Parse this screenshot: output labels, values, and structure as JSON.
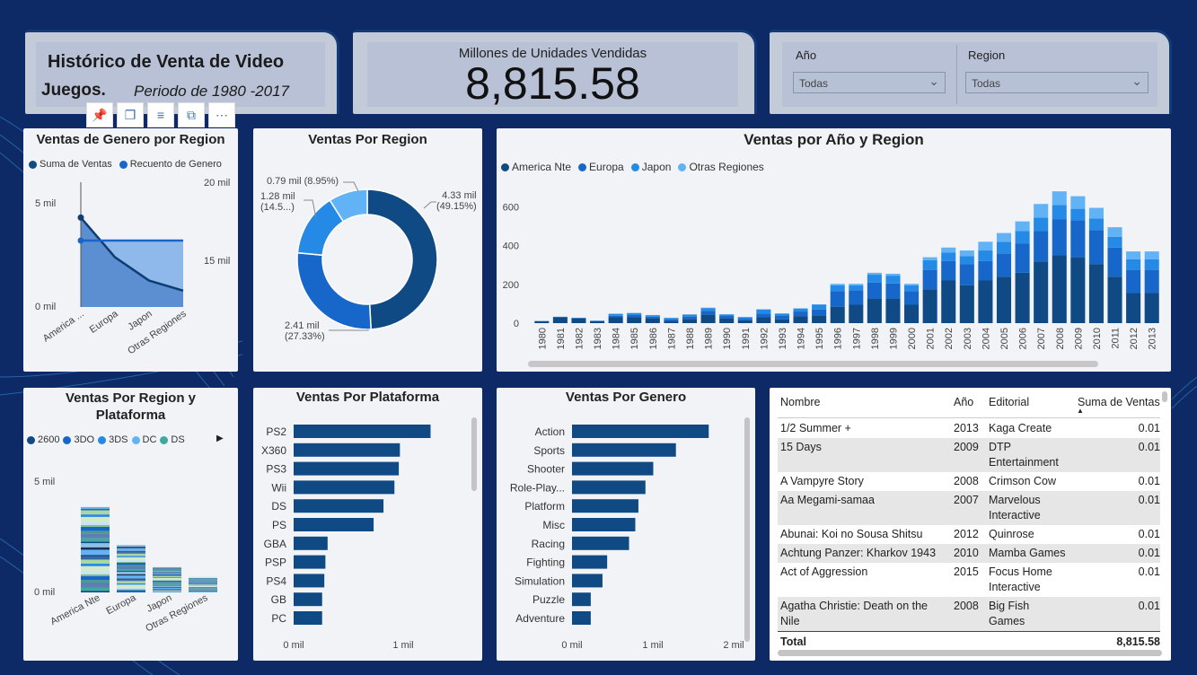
{
  "header": {
    "title_line1": "Histórico de Venta de Video",
    "title_line2": "Juegos.",
    "period": "Periodo de  1980 -2017",
    "kpi_label": "Millones de Unidades Vendidas",
    "kpi_value": "8,815.58"
  },
  "slicers": [
    {
      "label": "Año",
      "value": "Todas"
    },
    {
      "label": "Region",
      "value": "Todas"
    }
  ],
  "colors": {
    "navy": "#0f4a85",
    "blue": "#1766c9",
    "mid": "#2589e6",
    "light": "#61b3f5"
  },
  "genre_region": {
    "title": "Ventas de Genero por Region",
    "legend": [
      "Suma de Ventas",
      "Recuento de Genero"
    ],
    "y_left": [
      "5 mil",
      "0 mil"
    ],
    "y_right": [
      "20 mil",
      "15 mil"
    ],
    "categories": [
      "America ...",
      "Europa",
      "Japon",
      "Otras Regiones"
    ],
    "chart_data": {
      "type": "area",
      "categories": [
        "America Nte",
        "Europa",
        "Japon",
        "Otras Regiones"
      ],
      "series": [
        {
          "name": "Suma de Ventas",
          "values": [
            4.33,
            2.41,
            1.28,
            0.79
          ]
        },
        {
          "name": "Recuento de Genero",
          "values": [
            16600,
            16600,
            16600,
            16600
          ]
        }
      ]
    }
  },
  "region_donut": {
    "title": "Ventas Por Region",
    "labels": {
      "a1": "4.33 mil",
      "a2": "(49.15%)",
      "b1": "2.41 mil",
      "b2": "(27.33%)",
      "c1": "1.28 mil",
      "c2": "(14.5...)",
      "d1": "0.79 mil (8.95%)"
    },
    "chart_data": {
      "type": "pie",
      "categories": [
        "America Nte",
        "Europa",
        "Japon",
        "Otras Regiones"
      ],
      "values": [
        4.33,
        2.41,
        1.28,
        0.79
      ],
      "percent": [
        49.15,
        27.33,
        14.5,
        8.95
      ]
    }
  },
  "year_region": {
    "title": "Ventas por Año y Region",
    "legend": [
      "America Nte",
      "Europa",
      "Japon",
      "Otras Regiones"
    ],
    "y_ticks": [
      "600",
      "400",
      "200",
      "0"
    ],
    "chart_data": {
      "type": "bar",
      "stacked": true,
      "ylim": [
        0,
        700
      ],
      "categories": [
        "1980",
        "1981",
        "1982",
        "1983",
        "1984",
        "1985",
        "1986",
        "1987",
        "1988",
        "1989",
        "1990",
        "1991",
        "1992",
        "1993",
        "1994",
        "1995",
        "1996",
        "1997",
        "1998",
        "1999",
        "2000",
        "2001",
        "2002",
        "2003",
        "2004",
        "2005",
        "2006",
        "2007",
        "2008",
        "2009",
        "2010",
        "2011",
        "2012",
        "2013"
      ],
      "series": [
        {
          "name": "America Nte",
          "values": [
            10,
            30,
            25,
            10,
            30,
            30,
            25,
            12,
            22,
            45,
            25,
            15,
            30,
            20,
            35,
            40,
            85,
            95,
            125,
            125,
            95,
            175,
            220,
            195,
            220,
            240,
            260,
            315,
            350,
            340,
            305,
            240,
            155,
            155
          ]
        },
        {
          "name": "Europa",
          "values": [
            1,
            2,
            2,
            2,
            8,
            12,
            8,
            8,
            12,
            18,
            12,
            8,
            20,
            17,
            25,
            30,
            80,
            75,
            85,
            80,
            70,
            100,
            100,
            110,
            100,
            120,
            150,
            160,
            185,
            190,
            175,
            150,
            120,
            120
          ]
        },
        {
          "name": "Japon",
          "values": [
            0,
            1,
            1,
            1,
            10,
            10,
            8,
            7,
            10,
            15,
            8,
            8,
            20,
            12,
            15,
            25,
            30,
            25,
            40,
            40,
            30,
            50,
            45,
            40,
            55,
            60,
            65,
            70,
            75,
            60,
            60,
            55,
            55,
            55
          ]
        },
        {
          "name": "Otras Regiones",
          "values": [
            0,
            0,
            0,
            0,
            1,
            1,
            1,
            1,
            1,
            2,
            1,
            1,
            2,
            1,
            2,
            2,
            8,
            8,
            10,
            10,
            8,
            15,
            25,
            30,
            45,
            45,
            50,
            70,
            70,
            65,
            55,
            50,
            40,
            40
          ]
        }
      ]
    }
  },
  "region_platform": {
    "title_line1": "Ventas Por Region y",
    "title_line2": "Plataforma",
    "legend": [
      "2600",
      "3DO",
      "3DS",
      "DC",
      "DS"
    ],
    "legend_colors": [
      "#0f4a85",
      "#1766c9",
      "#2589e6",
      "#61b3f5",
      "#3fa8a0"
    ],
    "y_ticks": [
      "5 mil",
      "0 mil"
    ],
    "categories": [
      "America Nte",
      "Europa",
      "Japon",
      "Otras Regiones"
    ],
    "chart_data": {
      "type": "bar",
      "stacked": true,
      "categories": [
        "America Nte",
        "Europa",
        "Japon",
        "Otras Regiones"
      ],
      "values": [
        4.33,
        2.41,
        1.28,
        0.79
      ]
    }
  },
  "platform": {
    "title": "Ventas Por Plataforma",
    "x_ticks": [
      "0 mil",
      "1 mil"
    ],
    "chart_data": {
      "type": "bar",
      "orientation": "horizontal",
      "categories": [
        "PS2",
        "X360",
        "PS3",
        "Wii",
        "DS",
        "PS",
        "GBA",
        "PSP",
        "PS4",
        "GB",
        "PC"
      ],
      "values": [
        1.25,
        0.97,
        0.96,
        0.92,
        0.82,
        0.73,
        0.31,
        0.29,
        0.28,
        0.26,
        0.26
      ]
    }
  },
  "genre": {
    "title": "Ventas Por Genero",
    "x_ticks": [
      "0 mil",
      "1 mil",
      "2 mil"
    ],
    "chart_data": {
      "type": "bar",
      "orientation": "horizontal",
      "categories": [
        "Action",
        "Sports",
        "Shooter",
        "Role-Play...",
        "Platform",
        "Misc",
        "Racing",
        "Fighting",
        "Simulation",
        "Puzzle",
        "Adventure"
      ],
      "values": [
        1.75,
        1.33,
        1.04,
        0.94,
        0.85,
        0.81,
        0.73,
        0.45,
        0.39,
        0.24,
        0.24
      ]
    }
  },
  "table": {
    "headers": [
      "Nombre",
      "Año",
      "Editorial",
      "Suma de Ventas"
    ],
    "rows": [
      {
        "name": "1/2 Summer +",
        "year": "2013",
        "pub": "Kaga Create",
        "pub2": "",
        "name2": "",
        "val": "0.01"
      },
      {
        "name": "15 Days",
        "year": "2009",
        "pub": "DTP",
        "pub2": "Entertainment",
        "name2": "",
        "val": "0.01"
      },
      {
        "name": "A Vampyre Story",
        "year": "2008",
        "pub": "Crimson Cow",
        "pub2": "",
        "name2": "",
        "val": "0.01"
      },
      {
        "name": "Aa Megami-samaa",
        "year": "2007",
        "pub": "Marvelous",
        "pub2": "Interactive",
        "name2": "",
        "val": "0.01"
      },
      {
        "name": "Abunai: Koi no Sousa Shitsu",
        "year": "2012",
        "pub": "Quinrose",
        "pub2": "",
        "name2": "",
        "val": "0.01"
      },
      {
        "name": "Achtung Panzer: Kharkov 1943",
        "year": "2010",
        "pub": "Mamba Games",
        "pub2": "",
        "name2": "",
        "val": "0.01"
      },
      {
        "name": "Act of Aggression",
        "year": "2015",
        "pub": "Focus Home",
        "pub2": "Interactive",
        "name2": "",
        "val": "0.01"
      },
      {
        "name": "Agatha Christie: Death on the",
        "year": "2008",
        "pub": "Big Fish",
        "pub2": "Games",
        "name2": "Nile",
        "val": "0.01"
      }
    ],
    "total_label": "Total",
    "total_value": "8,815.58"
  },
  "visual_header_icons": [
    "pin-icon",
    "copy-icon",
    "filter-icon",
    "focus-icon",
    "more-icon"
  ]
}
